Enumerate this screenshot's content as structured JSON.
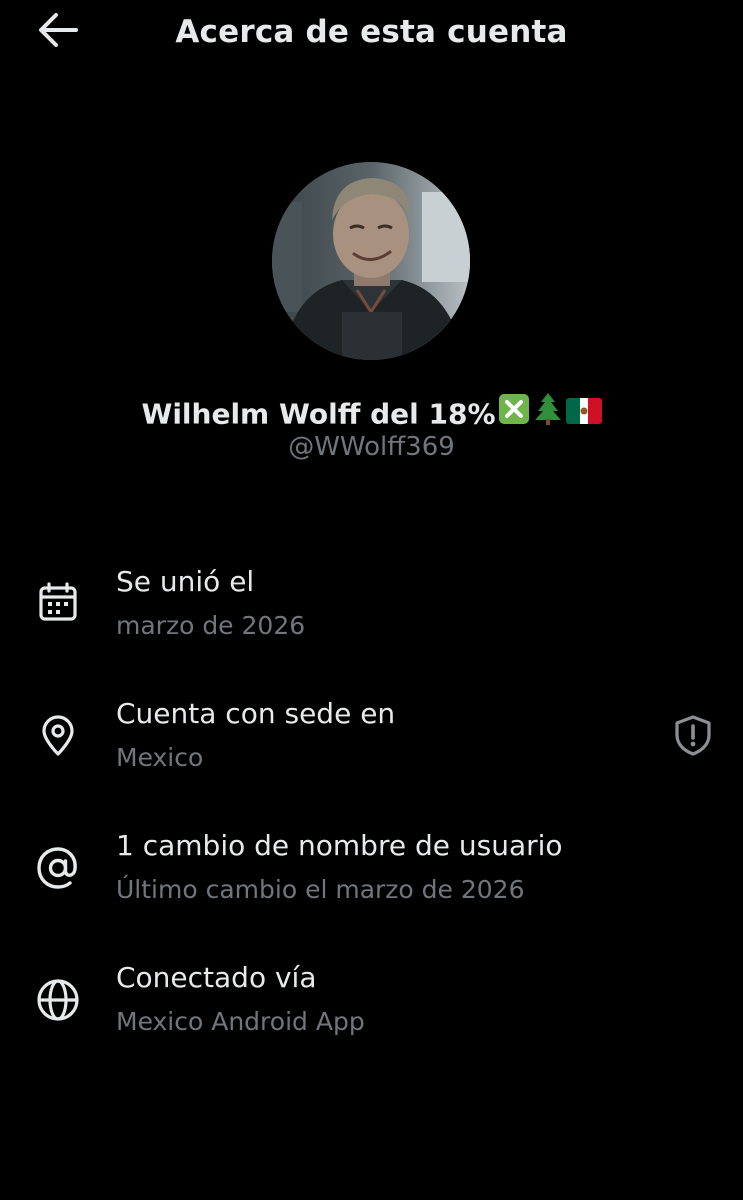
{
  "header": {
    "title": "Acerca de esta cuenta",
    "back_icon": "arrow-left-icon"
  },
  "profile": {
    "display_name": "Wilhelm Wolff del 18%",
    "name_emojis": [
      "cross-mark-button-emoji",
      "evergreen-tree-emoji",
      "mexico-flag-emoji"
    ],
    "handle": "@WWolff369"
  },
  "details": [
    {
      "icon": "calendar-icon",
      "title": "Se unió el",
      "subtitle": "marzo de 2026"
    },
    {
      "icon": "location-pin-icon",
      "title": "Cuenta con sede en",
      "subtitle": "Mexico",
      "trailing_icon": "shield-alert-icon"
    },
    {
      "icon": "at-sign-icon",
      "title": "1 cambio de nombre de usuario",
      "subtitle": "Último cambio el marzo de 2026"
    },
    {
      "icon": "globe-icon",
      "title": "Conectado vía",
      "subtitle": "Mexico Android App"
    }
  ],
  "colors": {
    "background": "#000000",
    "primary_text": "#e7e9ea",
    "secondary_text": "#71767b"
  }
}
